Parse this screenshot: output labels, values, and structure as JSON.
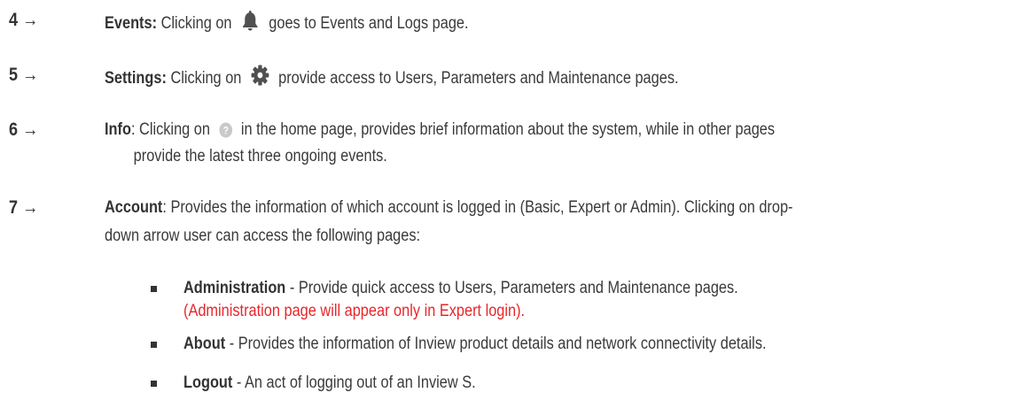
{
  "items": [
    {
      "number": "4",
      "arrow": "→",
      "term": "Events:",
      "text_before_icon": "Clicking on",
      "icon": "bell-icon",
      "text_after_icon": "goes to Events and Logs page."
    },
    {
      "number": "5",
      "arrow": "→",
      "term": "Settings:",
      "text_before_icon": "Clicking on",
      "icon": "gear-icon",
      "text_after_icon": "provide access to Users, Parameters and Maintenance pages."
    },
    {
      "number": "6",
      "arrow": "→",
      "term": "Info",
      "text_before_icon": ": Clicking on",
      "icon": "help-icon",
      "text_after_icon": "in the home page, provides brief information about the system, while in other pages",
      "text_line2": "provide the latest three ongoing events."
    },
    {
      "number": "7",
      "arrow": "→",
      "term": "Account",
      "text_line1": ": Provides the information of which account is logged in (Basic, Expert or Admin). Clicking on drop-",
      "text_line2": "down arrow user can access the following pages:"
    }
  ],
  "sub_items": [
    {
      "term": "Administration",
      "text": " - Provide quick access to Users, Parameters and Maintenance pages.",
      "note": "(Administration page will appear only in Expert login)."
    },
    {
      "term": "About",
      "text": " - Provides the information of Inview product details and network connectivity details."
    },
    {
      "term": "Logout",
      "text": " - An act of logging out of an Inview S."
    }
  ],
  "colors": {
    "text": "#3a3a3a",
    "note": "#e8262b",
    "icon": "#505050"
  }
}
